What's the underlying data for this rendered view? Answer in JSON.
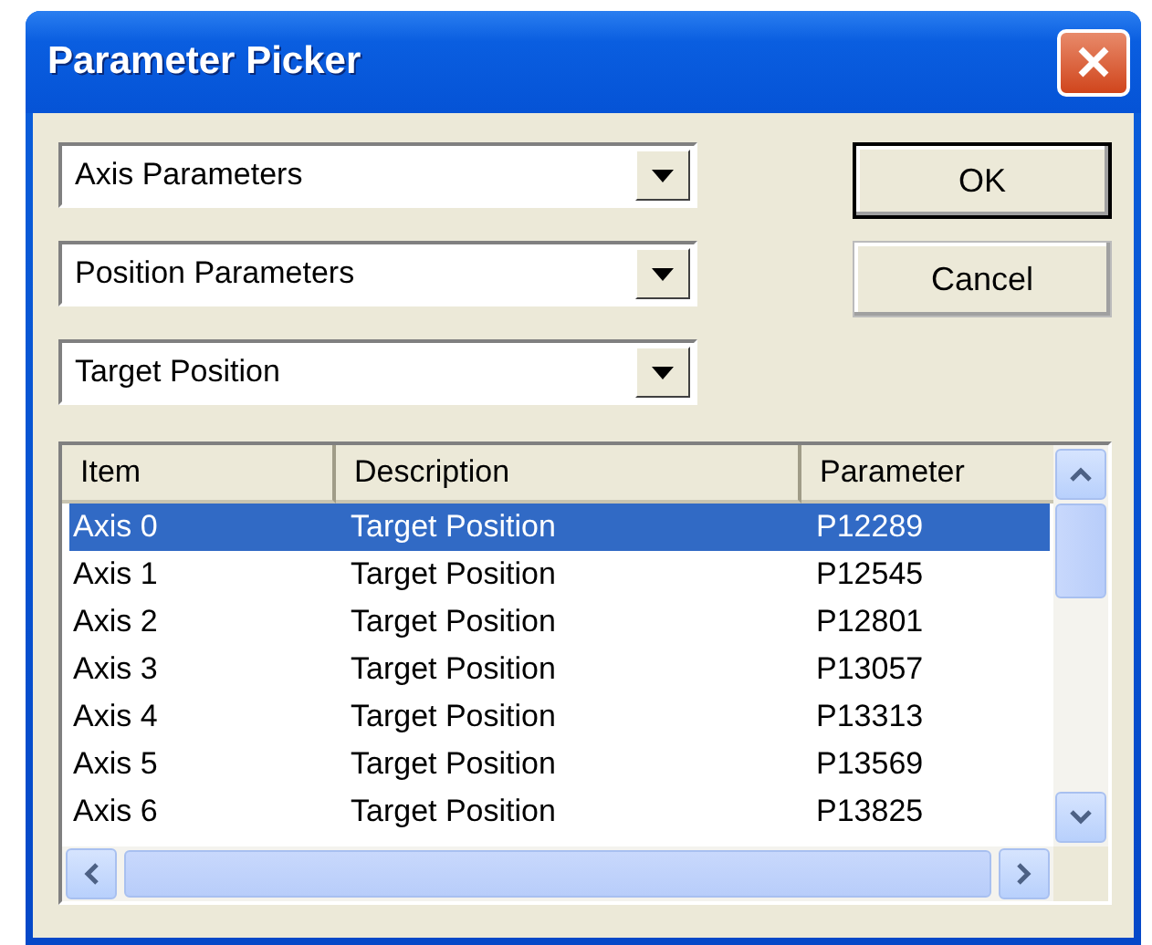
{
  "window": {
    "title": "Parameter Picker"
  },
  "dropdowns": [
    {
      "value": "Axis Parameters"
    },
    {
      "value": "Position Parameters"
    },
    {
      "value": "Target Position"
    }
  ],
  "buttons": [
    {
      "label": "OK",
      "default": true
    },
    {
      "label": "Cancel",
      "default": false
    }
  ],
  "table": {
    "columns": [
      "Item",
      "Description",
      "Parameter"
    ],
    "rows": [
      {
        "cells": [
          "Axis 0",
          "Target Position",
          "P12289"
        ],
        "selected": true
      },
      {
        "cells": [
          "Axis 1",
          "Target Position",
          "P12545"
        ],
        "selected": false
      },
      {
        "cells": [
          "Axis 2",
          "Target Position",
          "P12801"
        ],
        "selected": false
      },
      {
        "cells": [
          "Axis 3",
          "Target Position",
          "P13057"
        ],
        "selected": false
      },
      {
        "cells": [
          "Axis 4",
          "Target Position",
          "P13313"
        ],
        "selected": false
      },
      {
        "cells": [
          "Axis 5",
          "Target Position",
          "P13569"
        ],
        "selected": false
      },
      {
        "cells": [
          "Axis 6",
          "Target Position",
          "P13825"
        ],
        "selected": false
      }
    ]
  }
}
